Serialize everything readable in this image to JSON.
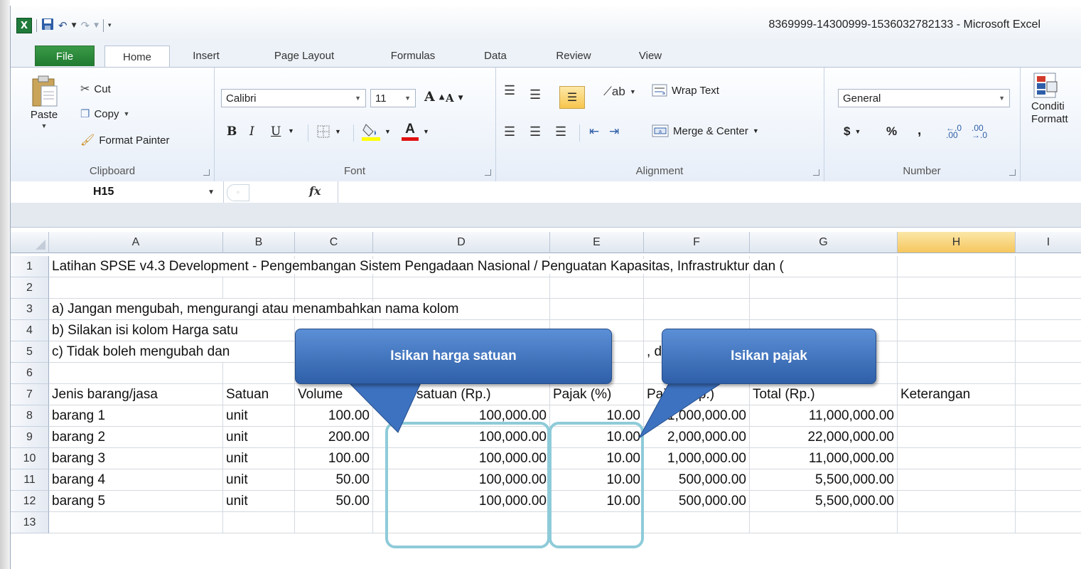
{
  "window": {
    "title": "8369999-14300999-1536032782133  -  Microsoft Excel",
    "app_logo": "X"
  },
  "tabs": [
    "File",
    "Home",
    "Insert",
    "Page Layout",
    "Formulas",
    "Data",
    "Review",
    "View"
  ],
  "ribbon": {
    "clipboard": {
      "paste": "Paste",
      "cut": "Cut",
      "copy": "Copy",
      "format_painter": "Format Painter",
      "label": "Clipboard"
    },
    "font": {
      "family": "Calibri",
      "size": "11",
      "bold": "B",
      "italic": "I",
      "underline": "U",
      "grow": "A",
      "shrink": "A",
      "font_color": "A",
      "label": "Font"
    },
    "alignment": {
      "wrap_text": "Wrap Text",
      "merge_center": "Merge & Center",
      "label": "Alignment"
    },
    "number": {
      "format": "General",
      "currency": "$",
      "percent": "%",
      "comma": ",",
      "label": "Number"
    },
    "styles": {
      "conditional_1": "Conditi",
      "conditional_2": "Formatt"
    }
  },
  "formula_bar": {
    "name_box": "H15",
    "fx": "fx",
    "value": ""
  },
  "columns": [
    "A",
    "B",
    "C",
    "D",
    "E",
    "F",
    "G",
    "H",
    "I"
  ],
  "selected_column": "H",
  "rows": [
    {
      "n": "1",
      "a": "Latihan SPSE v4.3 Development - Pengembangan Sistem Pengadaan Nasional / Penguatan Kapasitas, Infrastruktur dan ("
    },
    {
      "n": "2"
    },
    {
      "n": "3",
      "a": "a) Jangan mengubah, mengurangi atau menambahkan nama kolom"
    },
    {
      "n": "4",
      "a": "b) Silakan isi kolom Harga satu"
    },
    {
      "n": "5",
      "a": "c) Tidak boleh mengubah dan",
      "f": ", dan v"
    },
    {
      "n": "6"
    },
    {
      "n": "7",
      "a": "Jenis barang/jasa",
      "b": "Satuan",
      "c": "Volume",
      "d": "Harga satuan (Rp.)",
      "e": "Pajak (%)",
      "f": "Pajak (Rp.)",
      "g": "Total (Rp.)",
      "h": "Keterangan"
    },
    {
      "n": "8",
      "a": "barang 1",
      "b": "unit",
      "c": "100.00",
      "d": "100,000.00",
      "e": "10.00",
      "f": "1,000,000.00",
      "g": "11,000,000.00"
    },
    {
      "n": "9",
      "a": "barang 2",
      "b": "unit",
      "c": "200.00",
      "d": "100,000.00",
      "e": "10.00",
      "f": "2,000,000.00",
      "g": "22,000,000.00"
    },
    {
      "n": "10",
      "a": "barang 3",
      "b": "unit",
      "c": "100.00",
      "d": "100,000.00",
      "e": "10.00",
      "f": "1,000,000.00",
      "g": "11,000,000.00"
    },
    {
      "n": "11",
      "a": "barang 4",
      "b": "unit",
      "c": "50.00",
      "d": "100,000.00",
      "e": "10.00",
      "f": "500,000.00",
      "g": "5,500,000.00"
    },
    {
      "n": "12",
      "a": "barang 5",
      "b": "unit",
      "c": "50.00",
      "d": "100,000.00",
      "e": "10.00",
      "f": "500,000.00",
      "g": "5,500,000.00"
    },
    {
      "n": "13"
    }
  ],
  "callouts": {
    "harga": "Isikan harga satuan",
    "pajak": "Isikan pajak"
  },
  "colors": {
    "callout": "#3d72c0",
    "highlight": "#8ecbd9",
    "file_tab": "#2a8a3a",
    "selected_header": "#f5c65d"
  }
}
